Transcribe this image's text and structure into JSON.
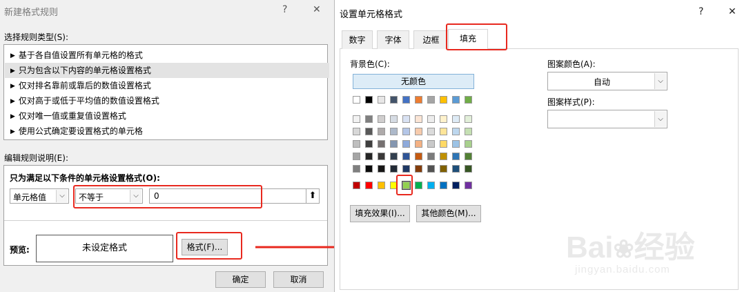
{
  "left_dialog": {
    "title": "新建格式规则",
    "help_glyph": "?",
    "close_glyph": "✕",
    "rule_type_label": "选择规则类型(S):",
    "rule_types": [
      "基于各自值设置所有单元格的格式",
      "只为包含以下内容的单元格设置格式",
      "仅对排名靠前或靠后的数值设置格式",
      "仅对高于或低于平均值的数值设置格式",
      "仅对唯一值或重复值设置格式",
      "使用公式确定要设置格式的单元格"
    ],
    "selected_rule_index": 1,
    "edit_label": "编辑规则说明(E):",
    "condition_heading": "只为满足以下条件的单元格设置格式(O):",
    "field1_value": "单元格值",
    "operator_value": "不等于",
    "value_input": "0",
    "preview_label": "预览:",
    "preview_text": "未设定格式",
    "format_button": "格式(F)...",
    "ok_button": "确定",
    "cancel_button": "取消"
  },
  "right_dialog": {
    "title": "设置单元格格式",
    "help_glyph": "?",
    "close_glyph": "✕",
    "tabs": [
      "数字",
      "字体",
      "边框",
      "填充"
    ],
    "active_tab_index": 3,
    "bg_color_label": "背景色(C):",
    "no_color_button": "无颜色",
    "pattern_color_label": "图案颜色(A):",
    "pattern_color_value": "自动",
    "pattern_style_label": "图案样式(P):",
    "pattern_style_value": "",
    "fill_effects_button": "填充效果(I)...",
    "more_colors_button": "其他颜色(M)..."
  },
  "palette": {
    "theme_row": [
      "#ffffff",
      "#000000",
      "#e7e6e6",
      "#44546a",
      "#4472c4",
      "#ed7d31",
      "#a5a5a5",
      "#ffc000",
      "#5b9bd5",
      "#70ad47"
    ],
    "tint_rows": [
      [
        "#f2f2f2",
        "#808080",
        "#d0cece",
        "#d6dce4",
        "#d9e2f3",
        "#fbe5d5",
        "#ededed",
        "#fff2cc",
        "#deebf6",
        "#e2efd9"
      ],
      [
        "#d8d8d8",
        "#595959",
        "#aeaaaa",
        "#adb9ca",
        "#b4c6e7",
        "#f7cbac",
        "#dbdbdb",
        "#fee599",
        "#bdd7ee",
        "#c5e0b3"
      ],
      [
        "#bfbfbf",
        "#3f3f3f",
        "#757070",
        "#8496b0",
        "#8eaadb",
        "#f4b183",
        "#c9c9c9",
        "#ffd965",
        "#9cc3e5",
        "#a8d08d"
      ],
      [
        "#a5a5a5",
        "#262626",
        "#3a3838",
        "#323f4f",
        "#2f5496",
        "#c55a11",
        "#7b7b7b",
        "#bf9000",
        "#2e75b5",
        "#538135"
      ],
      [
        "#7f7f7f",
        "#0c0c0c",
        "#171616",
        "#222a35",
        "#1f3864",
        "#833c0b",
        "#525252",
        "#7f6000",
        "#1e4e79",
        "#375623"
      ]
    ],
    "standard_row": [
      "#c00000",
      "#ff0000",
      "#ffc000",
      "#ffff00",
      "#92d050",
      "#00b050",
      "#00b0f0",
      "#0070c0",
      "#002060",
      "#7030a0"
    ],
    "selected_standard_index": 4,
    "accent_red": "#e8281e"
  },
  "watermark": {
    "brand": "Bai",
    "brand_suffix": "经验",
    "url": "jingyan.baidu.com"
  }
}
